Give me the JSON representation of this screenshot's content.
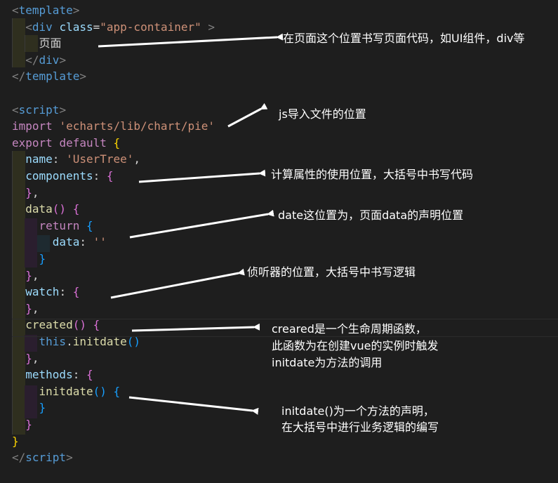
{
  "code": {
    "lines": [
      [
        {
          "t": "<",
          "c": "c-punc"
        },
        {
          "t": "template",
          "c": "c-tag"
        },
        {
          "t": ">",
          "c": "c-punc"
        }
      ],
      [
        {
          "t": "  "
        },
        {
          "t": "<",
          "c": "c-punc"
        },
        {
          "t": "div",
          "c": "c-tag"
        },
        {
          "t": " "
        },
        {
          "t": "class",
          "c": "c-attr"
        },
        {
          "t": "=",
          "c": "c-text"
        },
        {
          "t": "\"app-container\"",
          "c": "c-str"
        },
        {
          "t": " >",
          "c": "c-punc"
        }
      ],
      [
        {
          "t": "    "
        },
        {
          "t": "页面",
          "c": "c-text"
        }
      ],
      [
        {
          "t": "  "
        },
        {
          "t": "</",
          "c": "c-punc"
        },
        {
          "t": "div",
          "c": "c-tag"
        },
        {
          "t": ">",
          "c": "c-punc"
        }
      ],
      [
        {
          "t": "</",
          "c": "c-punc"
        },
        {
          "t": "template",
          "c": "c-tag"
        },
        {
          "t": ">",
          "c": "c-punc"
        }
      ],
      [],
      [
        {
          "t": "<",
          "c": "c-punc"
        },
        {
          "t": "script",
          "c": "c-tag"
        },
        {
          "t": ">",
          "c": "c-punc"
        }
      ],
      [
        {
          "t": "import",
          "c": "c-kw"
        },
        {
          "t": " "
        },
        {
          "t": "'echarts/lib/chart/pie'",
          "c": "c-str"
        }
      ],
      [
        {
          "t": "export",
          "c": "c-kw"
        },
        {
          "t": " "
        },
        {
          "t": "default",
          "c": "c-kw"
        },
        {
          "t": " "
        },
        {
          "t": "{",
          "c": "c-brace"
        }
      ],
      [
        {
          "t": "  "
        },
        {
          "t": "name",
          "c": "c-key"
        },
        {
          "t": ": ",
          "c": "c-text"
        },
        {
          "t": "'UserTree'",
          "c": "c-str"
        },
        {
          "t": ",",
          "c": "c-text"
        }
      ],
      [
        {
          "t": "  "
        },
        {
          "t": "components",
          "c": "c-key"
        },
        {
          "t": ": ",
          "c": "c-text"
        },
        {
          "t": "{",
          "c": "c-brace2"
        }
      ],
      [
        {
          "t": "  "
        },
        {
          "t": "}",
          "c": "c-brace2"
        },
        {
          "t": ",",
          "c": "c-text"
        }
      ],
      [
        {
          "t": "  "
        },
        {
          "t": "data",
          "c": "c-fn"
        },
        {
          "t": "() ",
          "c": "c-brace2"
        },
        {
          "t": "{",
          "c": "c-brace2"
        }
      ],
      [
        {
          "t": "    "
        },
        {
          "t": "return",
          "c": "c-kw"
        },
        {
          "t": " "
        },
        {
          "t": "{",
          "c": "c-brace3"
        }
      ],
      [
        {
          "t": "      "
        },
        {
          "t": "data",
          "c": "c-key"
        },
        {
          "t": ": ",
          "c": "c-text"
        },
        {
          "t": "''",
          "c": "c-str"
        }
      ],
      [
        {
          "t": "    "
        },
        {
          "t": "}",
          "c": "c-brace3"
        }
      ],
      [
        {
          "t": "  "
        },
        {
          "t": "}",
          "c": "c-brace2"
        },
        {
          "t": ",",
          "c": "c-text"
        }
      ],
      [
        {
          "t": "  "
        },
        {
          "t": "watch",
          "c": "c-key"
        },
        {
          "t": ": ",
          "c": "c-text"
        },
        {
          "t": "{",
          "c": "c-brace2"
        }
      ],
      [
        {
          "t": "  "
        },
        {
          "t": "}",
          "c": "c-brace2"
        },
        {
          "t": ",",
          "c": "c-text"
        }
      ],
      [
        {
          "t": "  "
        },
        {
          "t": "created",
          "c": "c-fn"
        },
        {
          "t": "() ",
          "c": "c-brace2"
        },
        {
          "t": "{",
          "c": "c-brace2"
        }
      ],
      [
        {
          "t": "    "
        },
        {
          "t": "this",
          "c": "c-tag"
        },
        {
          "t": ".",
          "c": "c-text"
        },
        {
          "t": "initdate",
          "c": "c-fn"
        },
        {
          "t": "()",
          "c": "c-brace3"
        }
      ],
      [
        {
          "t": "  "
        },
        {
          "t": "}",
          "c": "c-brace2"
        },
        {
          "t": ",",
          "c": "c-text"
        }
      ],
      [
        {
          "t": "  "
        },
        {
          "t": "methods",
          "c": "c-key"
        },
        {
          "t": ": ",
          "c": "c-text"
        },
        {
          "t": "{",
          "c": "c-brace2"
        }
      ],
      [
        {
          "t": "    "
        },
        {
          "t": "initdate",
          "c": "c-fn"
        },
        {
          "t": "() ",
          "c": "c-brace3"
        },
        {
          "t": "{",
          "c": "c-brace3"
        }
      ],
      [
        {
          "t": "    "
        },
        {
          "t": "}",
          "c": "c-brace3"
        }
      ],
      [
        {
          "t": "  "
        },
        {
          "t": "}",
          "c": "c-brace2"
        }
      ],
      [
        {
          "t": "}",
          "c": "c-brace"
        }
      ],
      [
        {
          "t": "</",
          "c": "c-punc"
        },
        {
          "t": "script",
          "c": "c-tag"
        },
        {
          "t": ">",
          "c": "c-punc"
        }
      ]
    ]
  },
  "annotations": {
    "page_code": "在页面这个位置书写页面代码，如UI组件，div等",
    "js_import": "js导入文件的位置",
    "components": "计算属性的使用位置，大括号中书写代码",
    "data": "date这位置为，页面data的声明位置",
    "watch": "侦听器的位置，大括号中书写逻辑",
    "created_1": "creared是一个生命周期函数，",
    "created_2": "此函数为在创建vue的实例时触发",
    "created_3": "initdate为方法的调用",
    "methods_1": "initdate()为一个方法的声明，",
    "methods_2": "在大括号中进行业务逻辑的编写"
  },
  "colors": {
    "background": "#1e1e1e",
    "arrow": "#ffffff",
    "tag": "#569cd6",
    "string": "#ce9178",
    "keyword": "#c586c0",
    "property": "#9cdcfe",
    "function": "#dcdcaa"
  }
}
